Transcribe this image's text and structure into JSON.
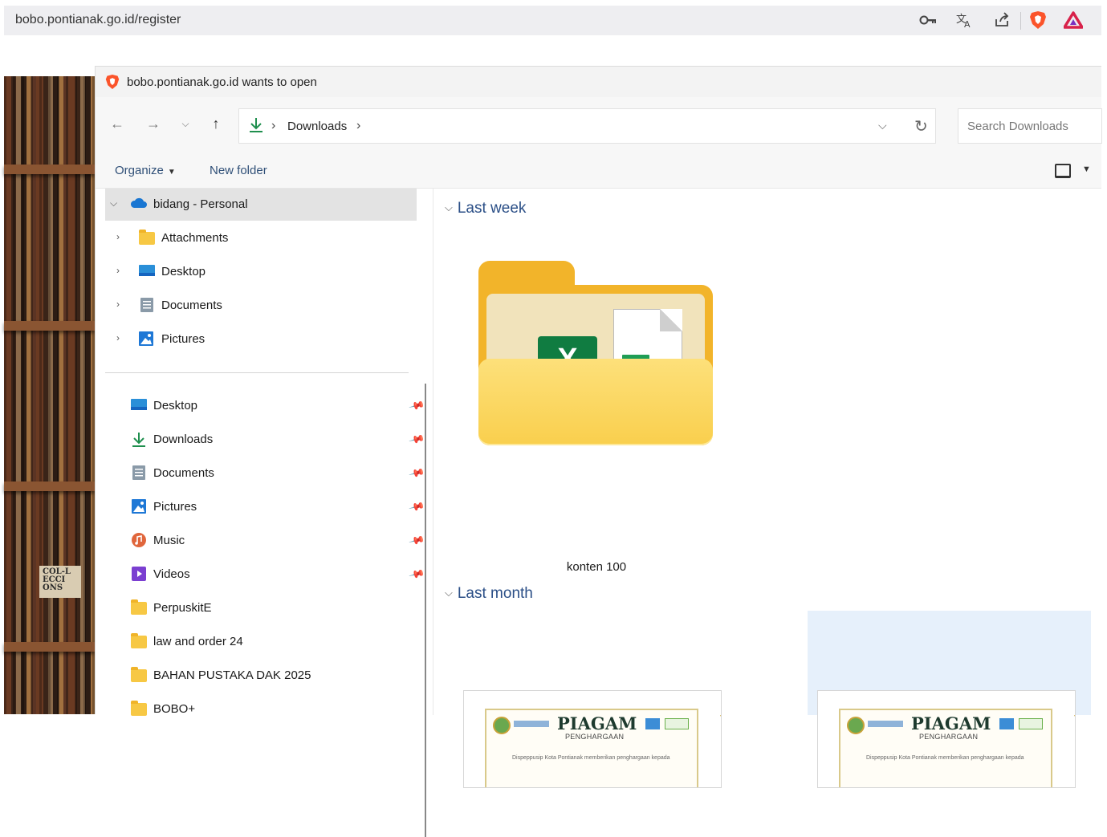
{
  "browser": {
    "url": "bobo.pontianak.go.id/register",
    "icons": [
      "key-icon",
      "translate-icon",
      "share-icon",
      "brave-shields-icon",
      "brave-rewards-icon"
    ]
  },
  "background": {
    "book_spine_text": "COL-L ECCI ONS"
  },
  "dialog": {
    "title": "bobo.pontianak.go.id wants to open",
    "nav": {
      "path_root_icon": "download-arrow-icon",
      "path_segment": "Downloads",
      "search_placeholder": "Search Downloads"
    },
    "commands": {
      "organize": "Organize",
      "new_folder": "New folder"
    },
    "sidebar": {
      "onedrive": {
        "label": "bidang - Personal",
        "expanded": true
      },
      "tree": [
        {
          "label": "Attachments",
          "icon": "folder-icon"
        },
        {
          "label": "Desktop",
          "icon": "desktop-icon"
        },
        {
          "label": "Documents",
          "icon": "documents-icon"
        },
        {
          "label": "Pictures",
          "icon": "pictures-icon"
        }
      ],
      "quick_access": [
        {
          "label": "Desktop",
          "icon": "desktop-icon",
          "pinned": true
        },
        {
          "label": "Downloads",
          "icon": "download-arrow-icon",
          "pinned": true
        },
        {
          "label": "Documents",
          "icon": "documents-icon",
          "pinned": true
        },
        {
          "label": "Pictures",
          "icon": "pictures-icon",
          "pinned": true
        },
        {
          "label": "Music",
          "icon": "music-icon",
          "pinned": true
        },
        {
          "label": "Videos",
          "icon": "videos-icon",
          "pinned": true
        },
        {
          "label": "PerpuskitE",
          "icon": "folder-icon",
          "pinned": false
        },
        {
          "label": "law and order 24",
          "icon": "folder-icon",
          "pinned": false
        },
        {
          "label": "BAHAN PUSTAKA DAK 2025",
          "icon": "folder-icon",
          "pinned": false
        },
        {
          "label": "BOBO+",
          "icon": "folder-icon",
          "pinned": false
        }
      ]
    },
    "content": {
      "groups": [
        {
          "label": "Last week",
          "items": [
            {
              "name": "konten 100",
              "type": "folder"
            }
          ]
        },
        {
          "label": "Last month",
          "items": [
            {
              "type": "image",
              "thumb_title": "PIAGAM",
              "thumb_sub": "PENGHARGAAN",
              "thumb_desc": "Dispерpusip Kota Pontianak memberikan penghargaan kepada"
            },
            {
              "type": "image",
              "thumb_title": "PIAGAM",
              "thumb_sub": "PENGHARGAAN",
              "thumb_desc": "Dispерpusip Kota Pontianak memberikan penghargaan kepada",
              "selected": true
            }
          ]
        }
      ]
    }
  },
  "colors": {
    "accent_link": "#2b4f87",
    "folder_yellow": "#f2b42a",
    "excel_green": "#107c41",
    "brave_orange": "#fb542b",
    "selection_bg": "#e6f0fb"
  }
}
